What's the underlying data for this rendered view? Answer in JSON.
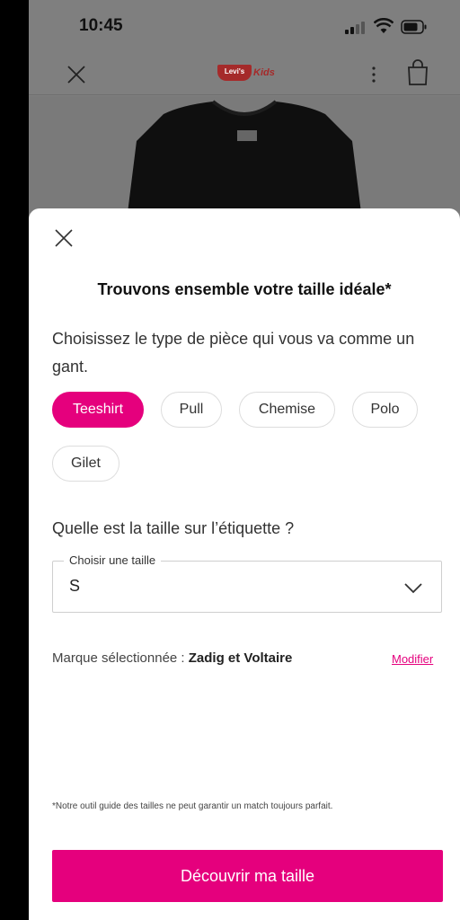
{
  "status_bar": {
    "time": "10:45"
  },
  "app_header": {
    "logo_text": "Levi's",
    "logo_kids": "Kids"
  },
  "colors": {
    "accent": "#e5007d",
    "overlay": "#7f7f7f",
    "brand_red": "#a52a2a"
  },
  "icons": {
    "header_close": "close-icon",
    "more": "more-vertical-icon",
    "bag": "shopping-bag-icon",
    "sheet_close": "close-icon",
    "select_chevron": "chevron-down-icon"
  },
  "sheet": {
    "title": "Trouvons ensemble votre taille idéale*",
    "subtitle": "Choisissez le type de pièce qui vous va comme un gant.",
    "chips": [
      {
        "label": "Teeshirt",
        "selected": true
      },
      {
        "label": "Pull",
        "selected": false
      },
      {
        "label": "Chemise",
        "selected": false
      },
      {
        "label": "Polo",
        "selected": false
      },
      {
        "label": "Gilet",
        "selected": false
      }
    ],
    "size_question": "Quelle est la taille sur l’étiquette ?",
    "size_select": {
      "label": "Choisir une taille",
      "value": "S"
    },
    "brand": {
      "prefix": "Marque sélectionnée : ",
      "name": "Zadig et Voltaire",
      "modify_label": "Modifier"
    },
    "disclaimer": "*Notre outil guide des tailles ne peut garantir un match toujours parfait.",
    "cta_label": "Découvrir ma taille"
  }
}
